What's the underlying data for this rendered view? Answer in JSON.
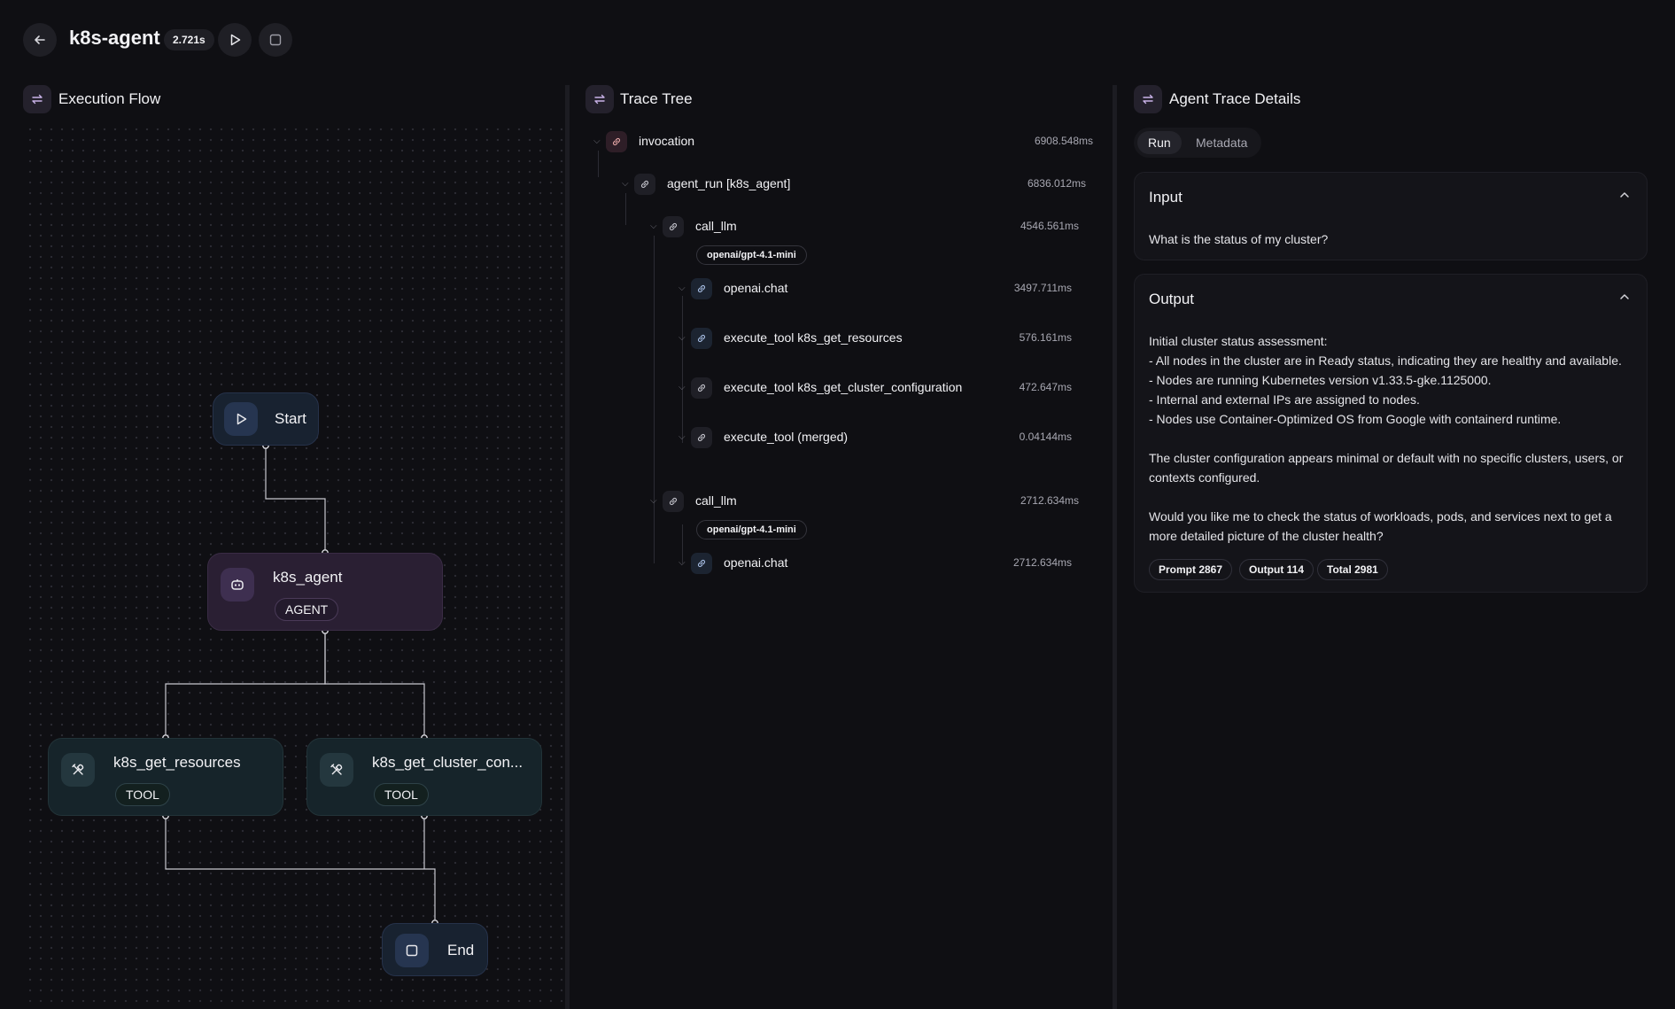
{
  "header": {
    "title": "k8s-agent",
    "duration": "2.721s",
    "back_icon": "arrow-left-icon",
    "run_icon": "play-icon",
    "stop_icon": "stop-icon"
  },
  "panels": {
    "flow_title": "Execution Flow",
    "tree_title": "Trace Tree",
    "details_title": "Agent Trace Details"
  },
  "flow": {
    "start_label": "Start",
    "agent_label": "k8s_agent",
    "agent_type": "AGENT",
    "tool1_label": "k8s_get_resources",
    "tool1_type": "TOOL",
    "tool2_label": "k8s_get_cluster_con...",
    "tool2_type": "TOOL",
    "end_label": "End"
  },
  "tree": [
    {
      "label": "invocation",
      "time": "6908.548ms"
    },
    {
      "label": "agent_run [k8s_agent]",
      "time": "6836.012ms"
    },
    {
      "label": "call_llm",
      "time": "4546.561ms",
      "model": "openai/gpt-4.1-mini"
    },
    {
      "label": "openai.chat",
      "time": "3497.711ms"
    },
    {
      "label": "execute_tool k8s_get_resources",
      "time": "576.161ms"
    },
    {
      "label": "execute_tool k8s_get_cluster_configuration",
      "time": "472.647ms"
    },
    {
      "label": "execute_tool (merged)",
      "time": "0.04144ms"
    },
    {
      "label": "call_llm",
      "time": "2712.634ms",
      "model": "openai/gpt-4.1-mini"
    },
    {
      "label": "openai.chat",
      "time": "2712.634ms"
    }
  ],
  "details": {
    "tabs": [
      "Run",
      "Metadata"
    ],
    "active_tab": "Run",
    "input_title": "Input",
    "input_text": "What is the status of my cluster?",
    "output_title": "Output",
    "output_text": "Initial cluster status assessment:\n- All nodes in the cluster are in Ready status, indicating they are healthy and available.\n- Nodes are running Kubernetes version v1.33.5-gke.1125000.\n- Internal and external IPs are assigned to nodes.\n- Nodes use Container-Optimized OS from Google with containerd runtime.\n\nThe cluster configuration appears minimal or default with no specific clusters, users, or contexts configured.\n\nWould you like me to check the status of workloads, pods, and services next to get a more detailed picture of the cluster health?",
    "tokens": [
      "Prompt 2867",
      "Output 114",
      "Total 2981"
    ]
  },
  "colors": {
    "background": "#0f0f13",
    "agent_accent": "#2a1f33",
    "tool_accent": "#16242a",
    "start_end_accent": "#182230"
  }
}
